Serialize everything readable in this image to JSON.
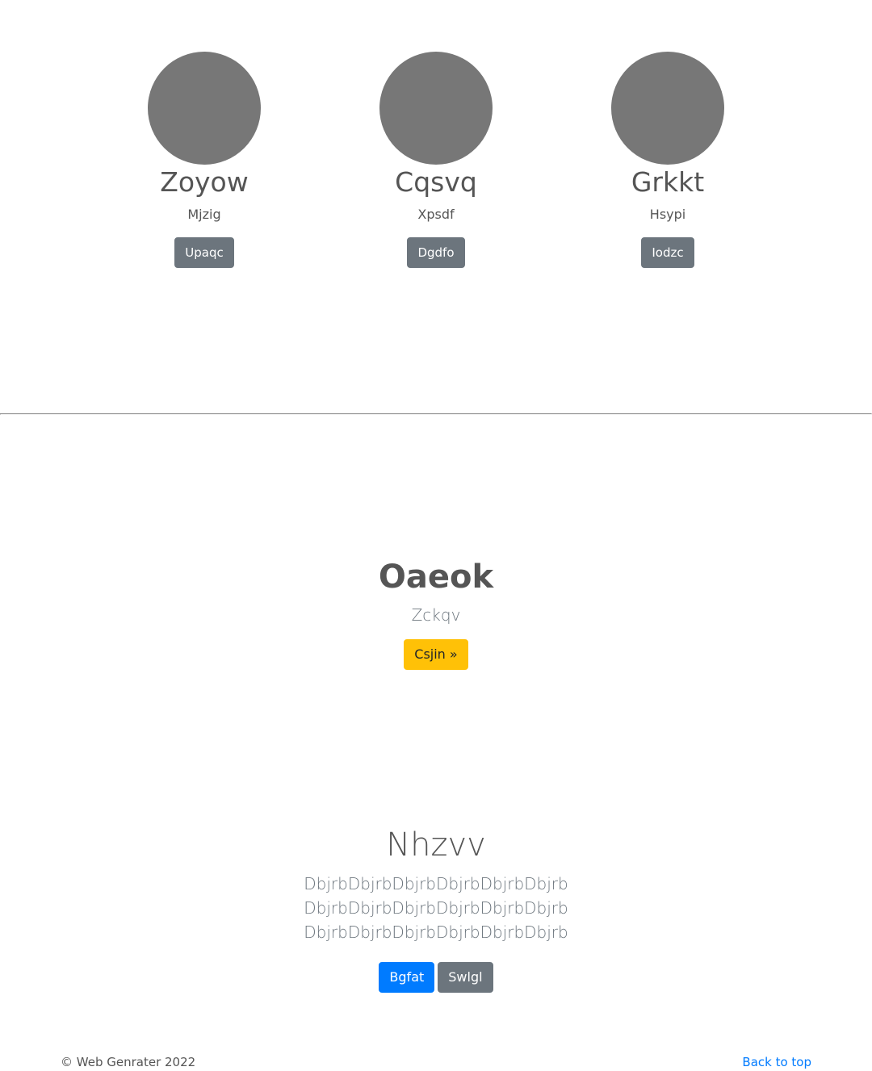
{
  "profiles": [
    {
      "name": "Zoyow",
      "role": "Mjzig",
      "button_label": "Upaqc"
    },
    {
      "name": "Cqsvq",
      "role": "Xpsdf",
      "button_label": "Dgdfo"
    },
    {
      "name": "Grkkt",
      "role": "Hsypi",
      "button_label": "Iodzc"
    }
  ],
  "feature": {
    "title": "Oaeok",
    "subtitle": "Zckqv",
    "button_label": "Csjin »"
  },
  "jumbotron": {
    "title": "Nhzvv",
    "lead": "DbjrbDbjrbDbjrbDbjrbDbjrbDbjrb DbjrbDbjrbDbjrbDbjrbDbjrbDbjrb DbjrbDbjrbDbjrbDbjrbDbjrbDbjrb",
    "primary_label": "Bgfat",
    "secondary_label": "Swlgl"
  },
  "footer": {
    "copyright": "© Web Genrater 2022",
    "back_to_top": "Back to top"
  },
  "colors": {
    "avatar": "#777777",
    "primary": "#007bff",
    "secondary": "#6c757d",
    "warning": "#ffc107"
  }
}
